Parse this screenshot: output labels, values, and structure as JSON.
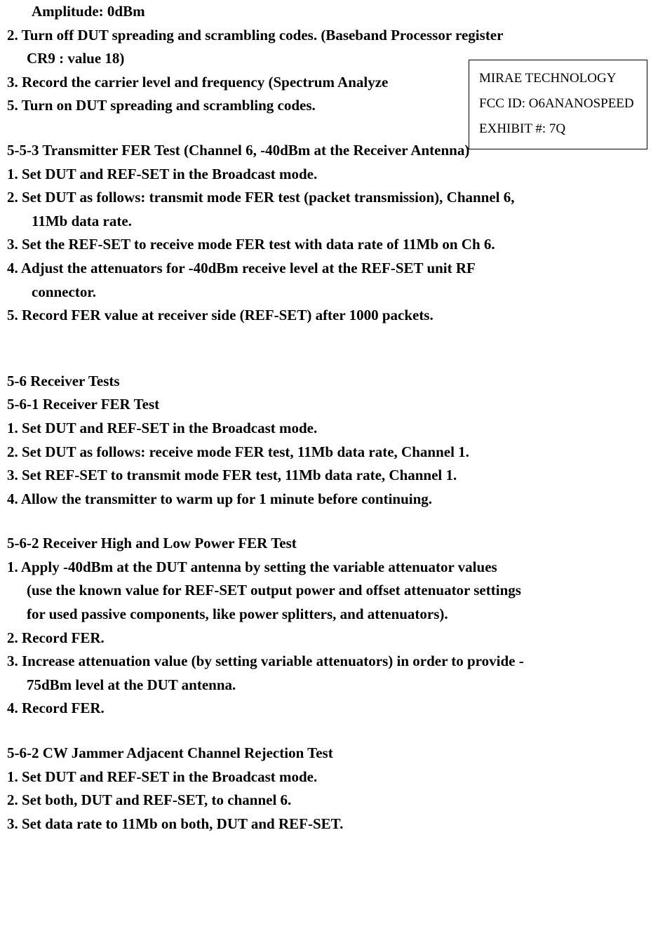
{
  "info_box": {
    "line1": "MIRAE TECHNOLOGY",
    "line2": "FCC ID:  O6ANANOSPEED",
    "line3": "EXHIBIT #: 7Q"
  },
  "top": {
    "amplitude": "Amplitude: 0dBm",
    "item2a": "2.  Turn off DUT spreading and scrambling codes. (Baseband Processor register",
    "item2b": "CR9 : value 18)",
    "item3": "3.  Record the carrier level and frequency (Spectrum Analyze",
    "item5": "5.    Turn on DUT spreading and scrambling codes."
  },
  "s553": {
    "heading": "5-5-3 Transmitter FER Test (Channel 6, -40dBm at the Receiver Antenna)",
    "item1": "1.  Set DUT and REF-SET in the Broadcast mode.",
    "item2a": "2.  Set DUT as follows: transmit mode FER test (packet transmission), Channel 6,",
    "item2b": "11Mb data rate.",
    "item3": "3.  Set the REF-SET to receive mode FER test with data rate of 11Mb on Ch 6.",
    "item4a": "4.   Adjust  the  attenuators  for  -40dBm  receive  level  at  the  REF-SET  unit  RF",
    "item4b": "connector.",
    "item5": "5.  Record FER value at receiver side (REF-SET) after 1000 packets."
  },
  "s56": {
    "heading": "5-6 Receiver Tests"
  },
  "s561": {
    "heading": "5-6-1 Receiver FER Test",
    "item1": "1.  Set DUT and REF-SET in the Broadcast mode.",
    "item2": "2.  Set DUT as follows: receive mode FER test, 11Mb data rate, Channel 1.",
    "item3": "3.  Set REF-SET to transmit mode FER test, 11Mb data rate, Channel 1.",
    "item4": "4.  Allow the transmitter to warm up for 1 minute before continuing."
  },
  "s562a": {
    "heading": "5-6-2 Receiver High and Low Power FER Test",
    "item1a": "1.   Apply -40dBm  at  the  DUT  antenna  by  setting  the  variable  attenuator  values",
    "item1b": "(use the known value for REF-SET output power and offset attenuator settings",
    "item1c": "for used passive components, like power splitters, and attenuators).",
    "item2": "2.  Record FER.",
    "item3a": "3.  Increase attenuation value (by setting variable attenuators) in order to provide -",
    "item3b": "75dBm level at the DUT antenna.",
    "item4": "4.  Record FER."
  },
  "s562b": {
    "heading": "5-6-2 CW Jammer Adjacent Channel Rejection Test",
    "item1": "1.  Set DUT and REF-SET in the Broadcast mode.",
    "item2": "2.  Set both, DUT and REF-SET, to channel 6.",
    "item3": "3.  Set data rate to 11Mb on both, DUT and REF-SET."
  }
}
